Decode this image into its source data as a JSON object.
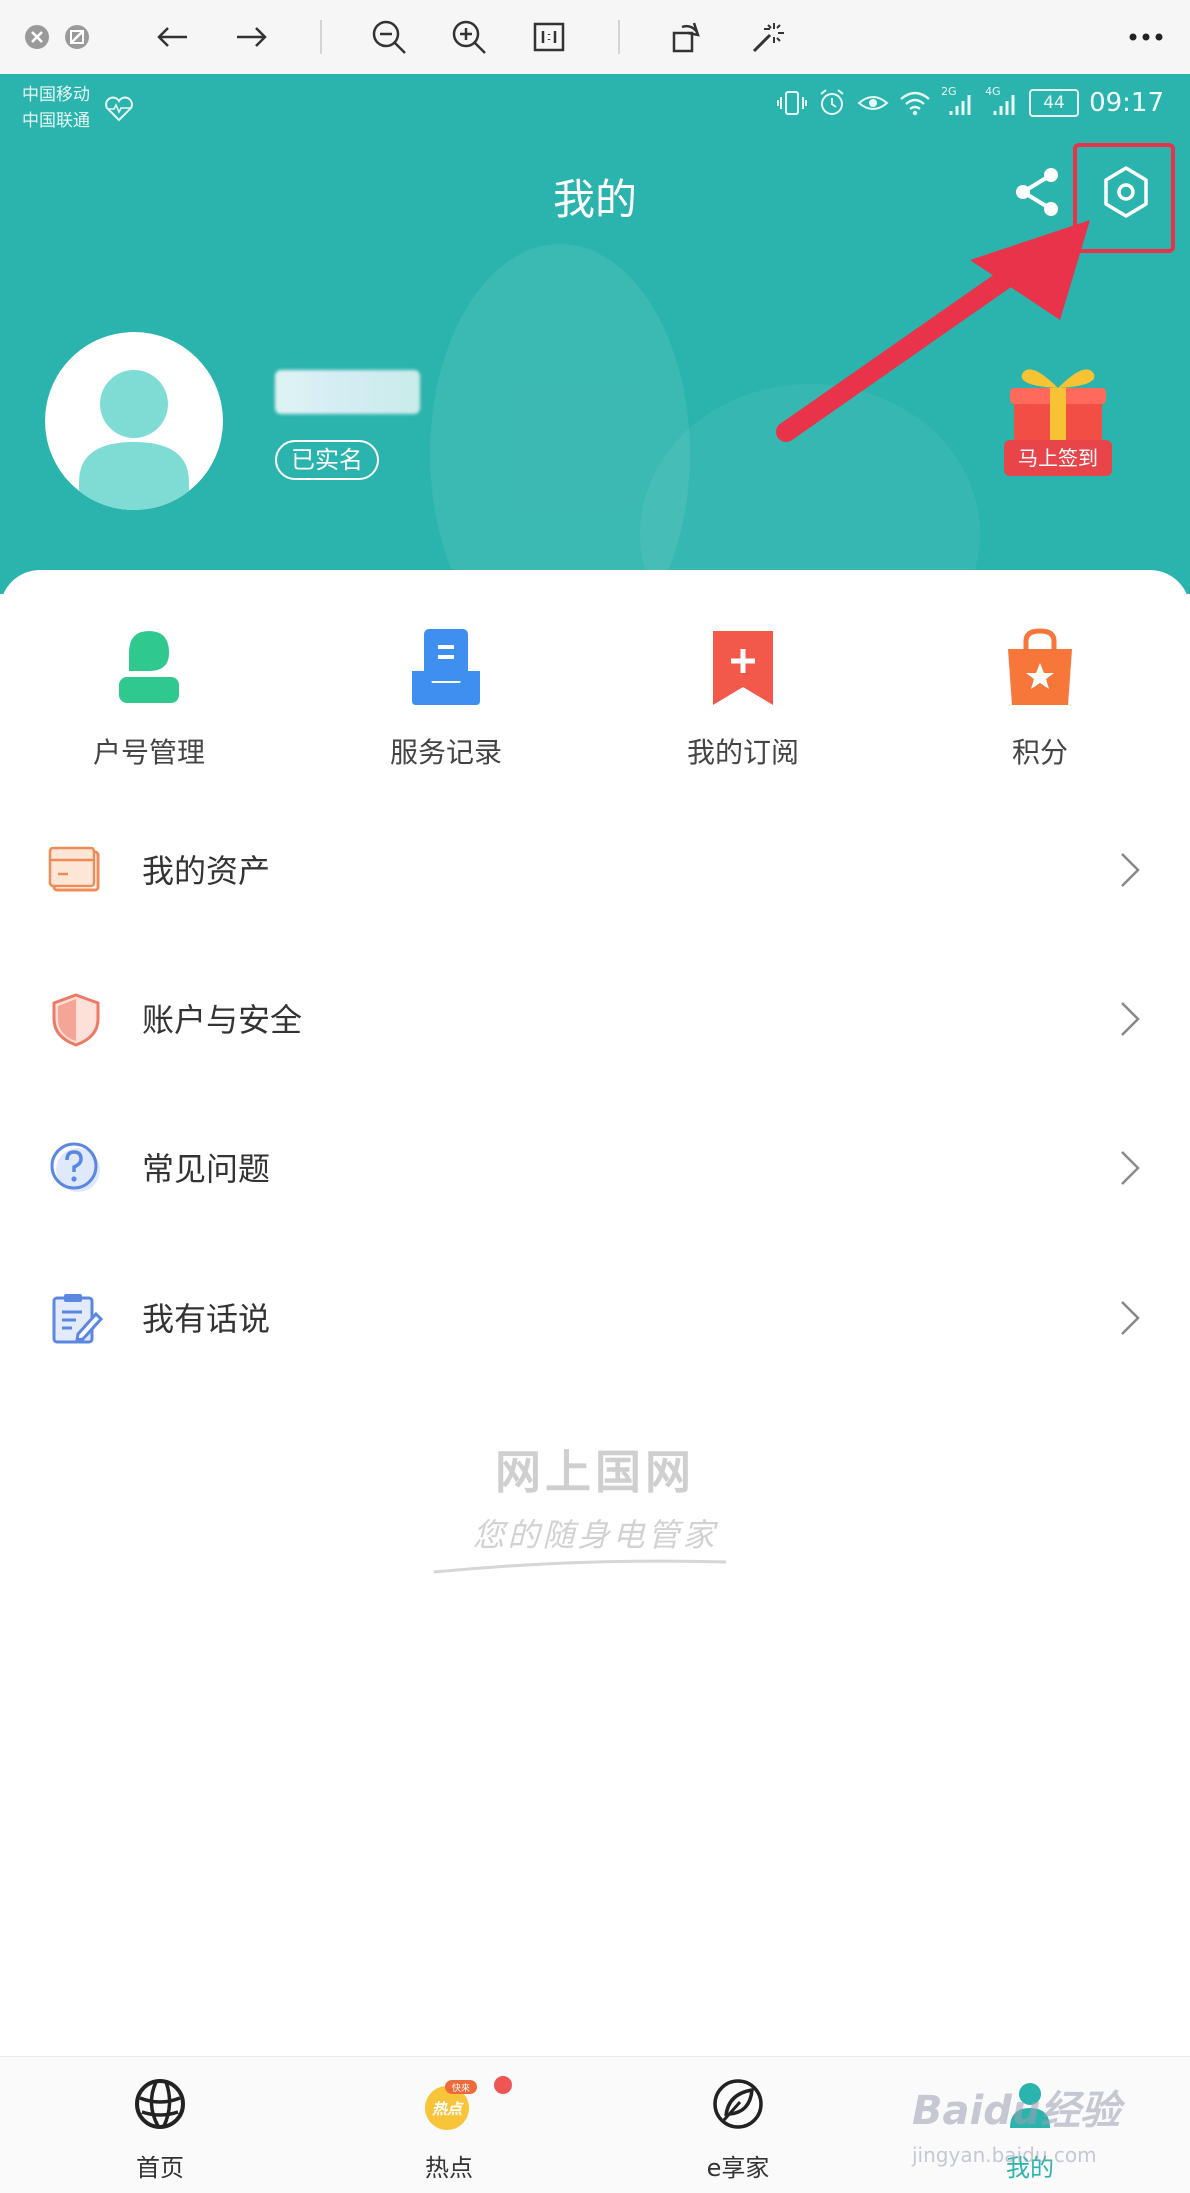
{
  "status_bar": {
    "carrier_1": "中国移动",
    "carrier_2": "中国联通",
    "network_a": "2G",
    "network_b": "4G",
    "battery": "44",
    "time": "09:17"
  },
  "header": {
    "title": "我的",
    "verified_badge": "已实名",
    "checkin_label": "马上签到"
  },
  "quick_actions": [
    {
      "label": "户号管理",
      "icon": "account-number-icon",
      "color": "#2fc98f"
    },
    {
      "label": "服务记录",
      "icon": "service-record-icon",
      "color": "#3f8ff0"
    },
    {
      "label": "我的订阅",
      "icon": "subscription-icon",
      "color": "#f2594b"
    },
    {
      "label": "积分",
      "icon": "points-bag-icon",
      "color": "#f7763a"
    }
  ],
  "menu": [
    {
      "label": "我的资产",
      "icon": "card-icon"
    },
    {
      "label": "账户与安全",
      "icon": "shield-icon"
    },
    {
      "label": "常见问题",
      "icon": "question-icon"
    },
    {
      "label": "我有话说",
      "icon": "feedback-icon"
    }
  ],
  "brand": {
    "name": "网上国网",
    "slogan": "您的随身电管家"
  },
  "tabs": [
    {
      "label": "首页",
      "icon": "globe-icon"
    },
    {
      "label": "热点",
      "icon": "hot-icon",
      "badge": "热点",
      "badge_top": "快來"
    },
    {
      "label": "e享家",
      "icon": "e-leaf-icon"
    },
    {
      "label": "我的",
      "icon": "profile-tab-icon"
    }
  ],
  "colors": {
    "brand_teal": "#2bb3ad",
    "annotation_red": "#e8334b"
  },
  "watermark": {
    "text": "Baidu经验",
    "url_text": "jingyan.baidu.com"
  }
}
